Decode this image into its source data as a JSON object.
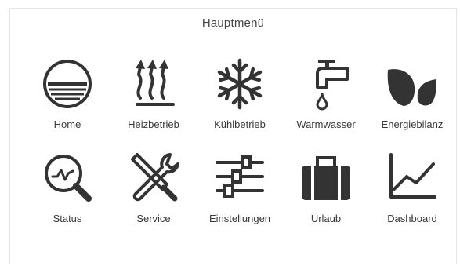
{
  "header": {
    "title": "Hauptmenü"
  },
  "menu": {
    "items": [
      {
        "label": "Home",
        "icon": "home-horizon-icon"
      },
      {
        "label": "Heizbetrieb",
        "icon": "heat-waves-icon"
      },
      {
        "label": "Kühlbetrieb",
        "icon": "snowflake-icon"
      },
      {
        "label": "Warmwasser",
        "icon": "faucet-icon"
      },
      {
        "label": "Energiebilanz",
        "icon": "leaves-icon"
      },
      {
        "label": "Status",
        "icon": "magnifier-pulse-icon"
      },
      {
        "label": "Service",
        "icon": "tools-icon"
      },
      {
        "label": "Einstellungen",
        "icon": "sliders-icon"
      },
      {
        "label": "Urlaub",
        "icon": "suitcase-icon"
      },
      {
        "label": "Dashboard",
        "icon": "line-chart-icon"
      }
    ]
  },
  "colors": {
    "icon": "#333333",
    "background": "#ffffff",
    "border": "#e6e6e6"
  }
}
